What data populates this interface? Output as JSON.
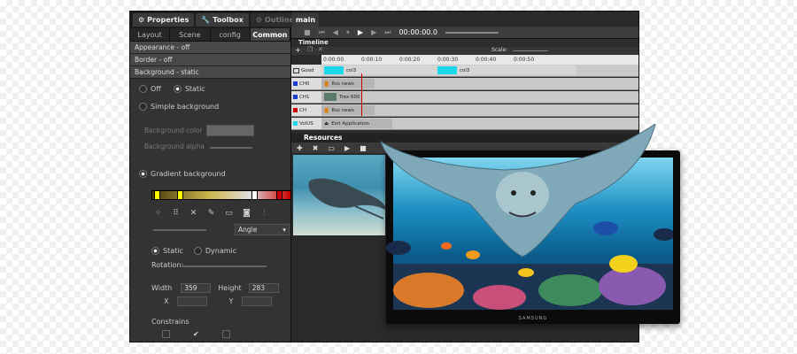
{
  "top_tabs": [
    {
      "label": "Properties",
      "icon": "gear-icon"
    },
    {
      "label": "Toolbox",
      "icon": "wrench-icon"
    },
    {
      "label": "Outline",
      "icon": "gear-icon"
    }
  ],
  "sub_tabs": [
    "Layout",
    "Scene",
    "config",
    "Common"
  ],
  "sections": {
    "appearance": "Appearance - off",
    "border": "Border - off",
    "background": "Background - static"
  },
  "background": {
    "off_label": "Off",
    "static_label": "Static",
    "simple_label": "Simple background",
    "color_label": "Background color",
    "alpha_label": "Background alpha",
    "gradient_label": "Gradient background",
    "gradient_type": "Angle",
    "static2_label": "Static",
    "dynamic_label": "Dynamic",
    "rotation_label": "Rotation:"
  },
  "geometry_fields": {
    "width_label": "Width",
    "width_value": "359",
    "height_label": "Height",
    "height_value": "283",
    "x_label": "X",
    "y_label": "Y",
    "constrains_label": "Constrains"
  },
  "main": {
    "tab": "main",
    "time": "00:00:00.0"
  },
  "timeline": {
    "title": "Timeline",
    "scale_label": "Scale:",
    "ruler": [
      "0:00:00",
      "0:00:10",
      "0:00:20",
      "0:00:30",
      "0:00:40",
      "0:00:50"
    ],
    "tracks": [
      {
        "name": "Good",
        "clip": "col3"
      },
      {
        "name": "CH0",
        "clip": "Rss news"
      },
      {
        "name": "CH1",
        "clip": "Trex 600"
      },
      {
        "name": "CH",
        "clip": "Rss news"
      },
      {
        "name": "VolUS",
        "clip": "Exit Application"
      }
    ],
    "clip_extra": "col3"
  },
  "resources": {
    "title": "Resources"
  },
  "tv": {
    "brand": "SAMSUNG"
  },
  "colors": {
    "panel_bg": "#333333",
    "accent_cyan": "#1ad8e8",
    "gradient_end": "#cc0000"
  }
}
